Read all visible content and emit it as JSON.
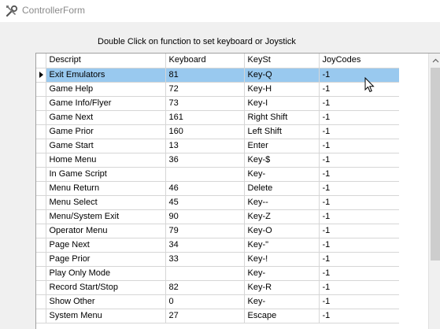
{
  "window": {
    "title": "ControllerForm",
    "icon": "wrench-screwdriver-icon"
  },
  "instruction": "Double Click on function to set keyboard or Joystick",
  "grid": {
    "columns": [
      "Descript",
      "Keyboard",
      "KeySt",
      "JoyCodes"
    ],
    "selected_row": 0,
    "rows": [
      {
        "descript": "Exit Emulators",
        "keyboard": "81",
        "keyst": "Key-Q",
        "joycodes": "-1"
      },
      {
        "descript": "Game Help",
        "keyboard": "72",
        "keyst": "Key-H",
        "joycodes": "-1"
      },
      {
        "descript": "Game Info/Flyer",
        "keyboard": "73",
        "keyst": "Key-I",
        "joycodes": "-1"
      },
      {
        "descript": "Game Next",
        "keyboard": "161",
        "keyst": "Right Shift",
        "joycodes": "-1"
      },
      {
        "descript": "Game Prior",
        "keyboard": "160",
        "keyst": "Left Shift",
        "joycodes": "-1"
      },
      {
        "descript": "Game Start",
        "keyboard": "13",
        "keyst": "Enter",
        "joycodes": "-1"
      },
      {
        "descript": "Home Menu",
        "keyboard": "36",
        "keyst": "Key-$",
        "joycodes": "-1"
      },
      {
        "descript": "In Game Script",
        "keyboard": "",
        "keyst": "Key-",
        "joycodes": "-1"
      },
      {
        "descript": "Menu Return",
        "keyboard": "46",
        "keyst": "Delete",
        "joycodes": "-1"
      },
      {
        "descript": "Menu Select",
        "keyboard": "45",
        "keyst": "Key--",
        "joycodes": "-1"
      },
      {
        "descript": "Menu/System Exit",
        "keyboard": "90",
        "keyst": "Key-Z",
        "joycodes": "-1"
      },
      {
        "descript": "Operator Menu",
        "keyboard": "79",
        "keyst": "Key-O",
        "joycodes": "-1"
      },
      {
        "descript": "Page Next",
        "keyboard": "34",
        "keyst": "Key-\"",
        "joycodes": "-1"
      },
      {
        "descript": "Page Prior",
        "keyboard": "33",
        "keyst": "Key-!",
        "joycodes": "-1"
      },
      {
        "descript": "Play Only Mode",
        "keyboard": "",
        "keyst": "Key-",
        "joycodes": "-1"
      },
      {
        "descript": "Record Start/Stop",
        "keyboard": "82",
        "keyst": "Key-R",
        "joycodes": "-1"
      },
      {
        "descript": "Show Other",
        "keyboard": "0",
        "keyst": "Key-",
        "joycodes": "-1"
      },
      {
        "descript": "System Menu",
        "keyboard": "27",
        "keyst": "Escape",
        "joycodes": "-1"
      }
    ]
  },
  "colors": {
    "selection": "#99c9ef",
    "gridline": "#d6d6d6"
  }
}
